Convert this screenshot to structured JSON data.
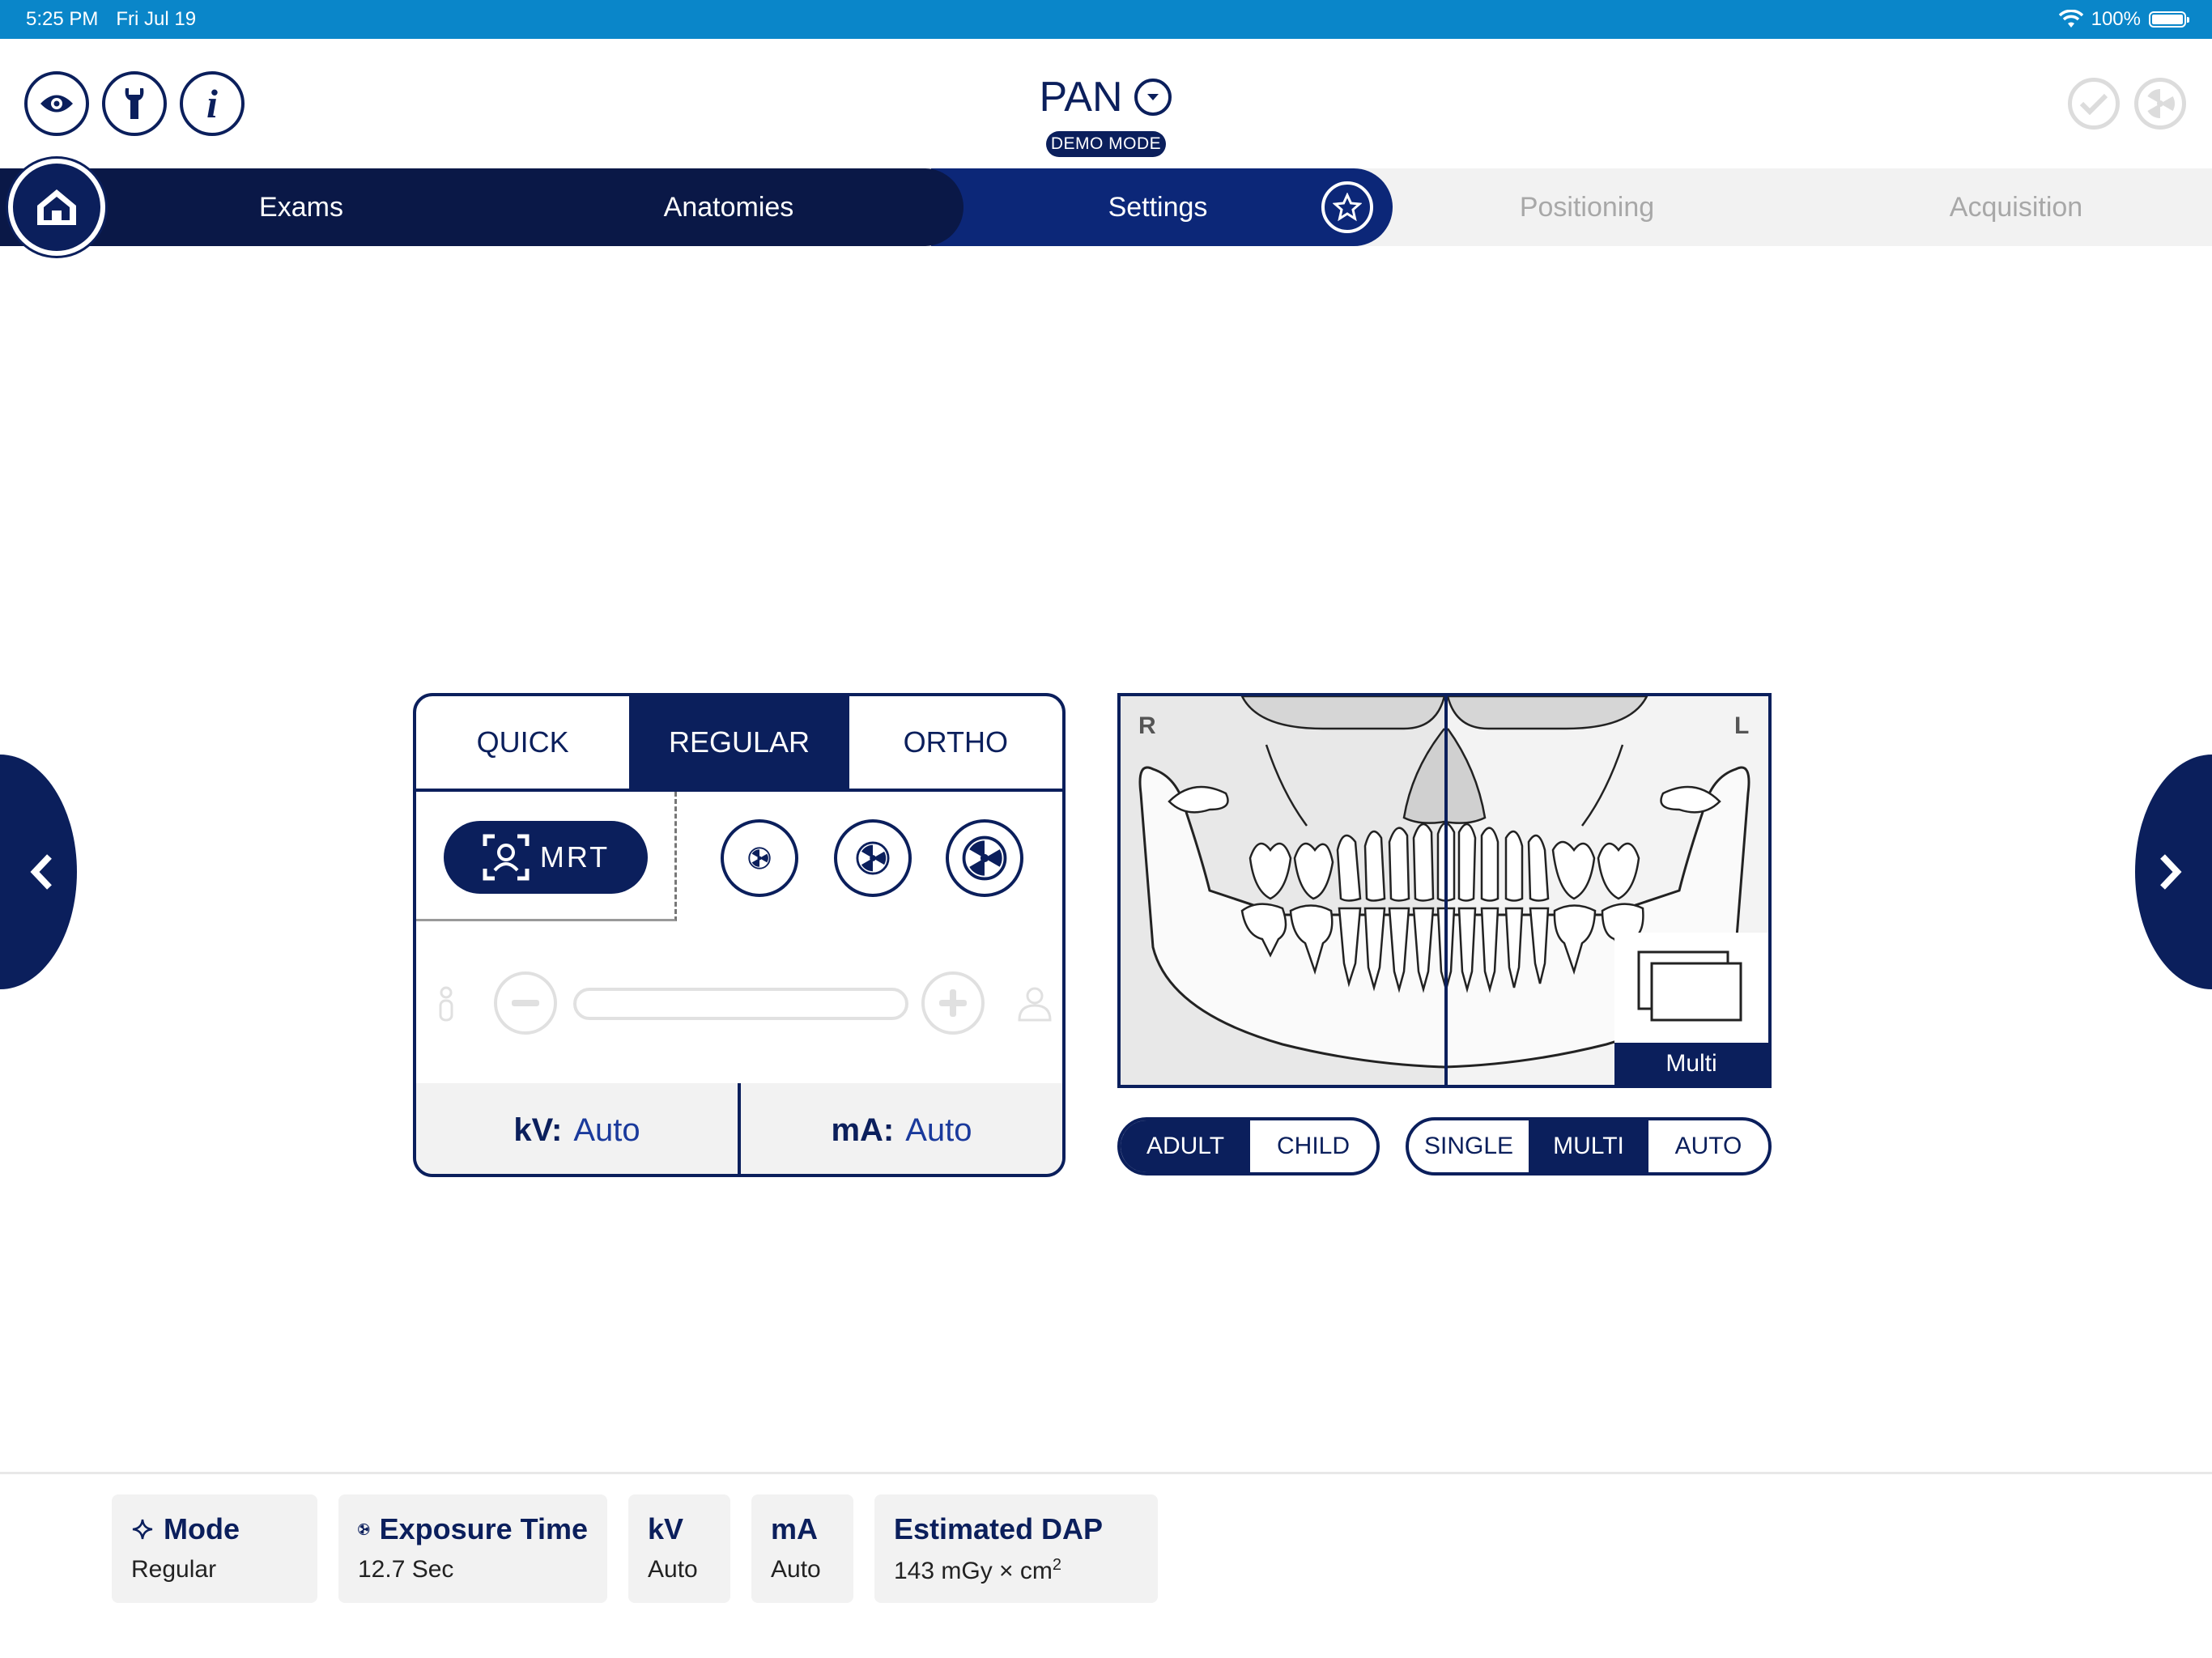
{
  "status_bar": {
    "time": "5:25 PM",
    "date": "Fri Jul 19",
    "battery": "100%"
  },
  "header": {
    "title": "PAN",
    "badge": "DEMO MODE"
  },
  "nav": {
    "tabs": [
      {
        "label": "Exams",
        "state": "done"
      },
      {
        "label": "Anatomies",
        "state": "done"
      },
      {
        "label": "Settings",
        "state": "active"
      },
      {
        "label": "Positioning",
        "state": "disabled"
      },
      {
        "label": "Acquisition",
        "state": "disabled"
      }
    ]
  },
  "exposure_panel": {
    "tabs": [
      "QUICK",
      "REGULAR",
      "ORTHO"
    ],
    "active_tab": "REGULAR",
    "mrt_label": "MRT",
    "kv_label": "kV:",
    "kv_value": "Auto",
    "ma_label": "mA:",
    "ma_value": "Auto"
  },
  "jaw_panel": {
    "right_label": "R",
    "left_label": "L",
    "multi_label": "Multi"
  },
  "patient_toggle": {
    "options": [
      "ADULT",
      "CHILD"
    ],
    "selected": "ADULT"
  },
  "image_toggle": {
    "options": [
      "SINGLE",
      "MULTI",
      "AUTO"
    ],
    "selected": "MULTI"
  },
  "footer": {
    "mode": {
      "label": "Mode",
      "value": "Regular"
    },
    "exposure_time": {
      "label": "Exposure Time",
      "value": "12.7 Sec"
    },
    "kv": {
      "label": "kV",
      "value": "Auto"
    },
    "ma": {
      "label": "mA",
      "value": "Auto"
    },
    "dap": {
      "label": "Estimated DAP",
      "value": "143 mGy × cm",
      "superscript": "2"
    }
  },
  "colors": {
    "primary": "#0b1f5c",
    "nav_dark": "#0a1847",
    "nav_active": "#0c2778",
    "status_bar": "#0a86c9"
  }
}
